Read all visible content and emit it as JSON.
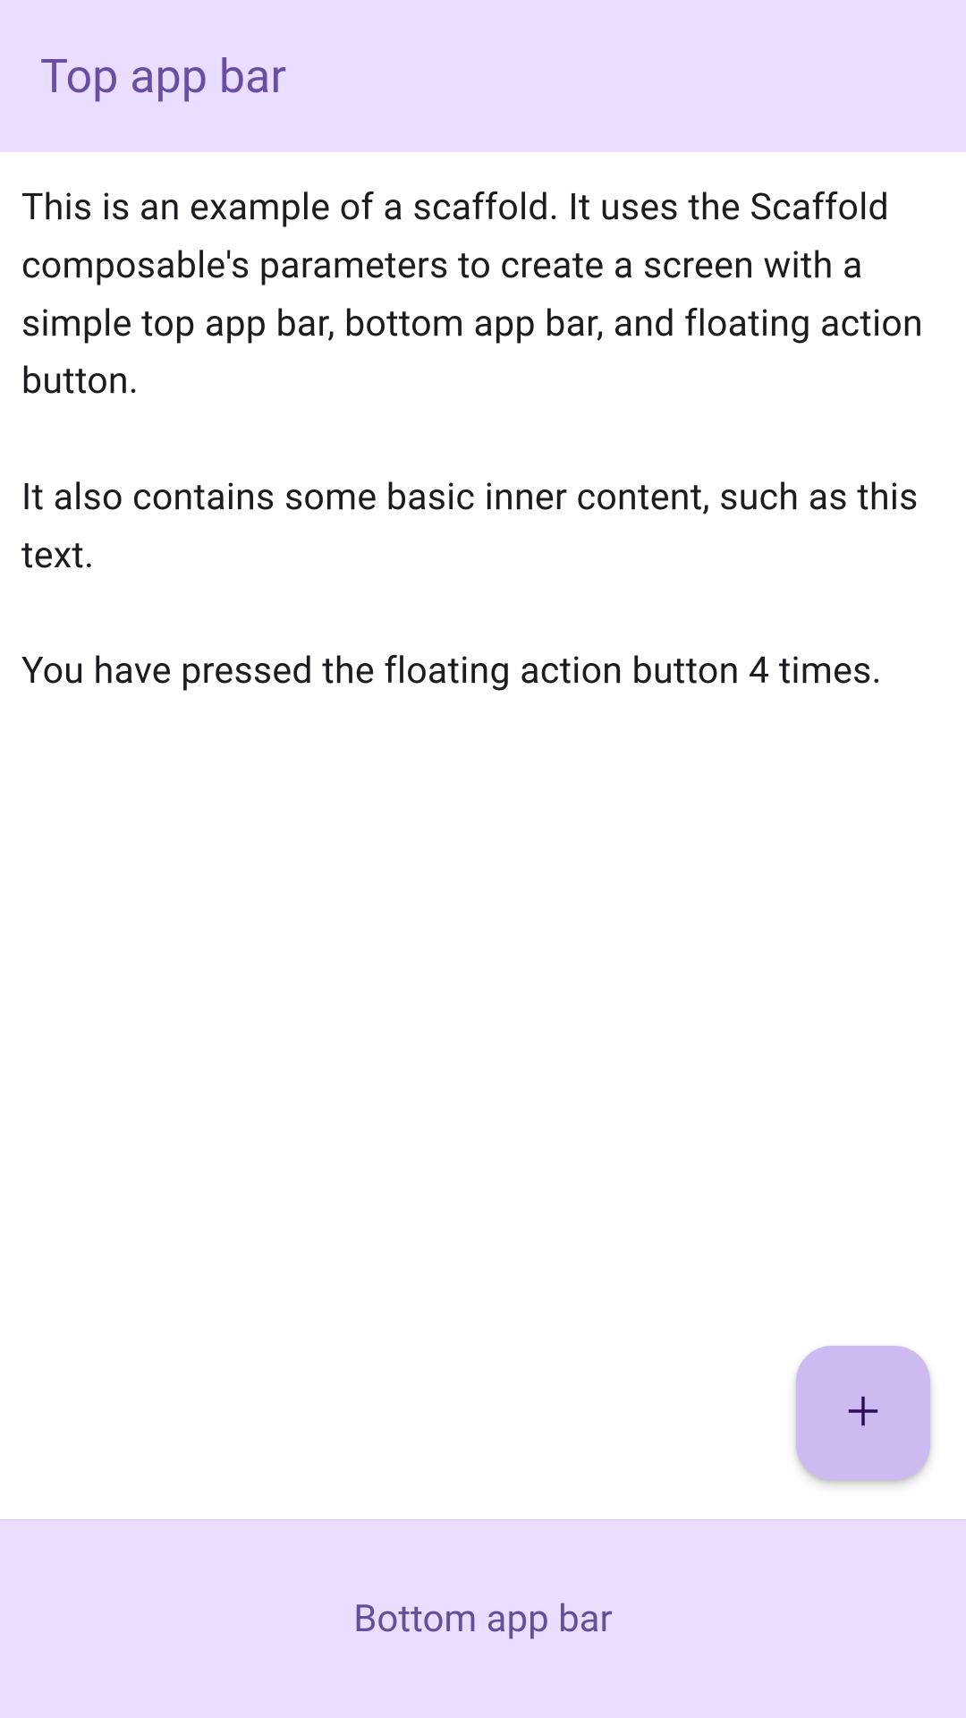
{
  "topBar": {
    "title": "Top app bar"
  },
  "content": {
    "text": "This is an example of a scaffold. It uses the Scaffold composable's parameters to create a screen with a simple top app bar, bottom app bar, and floating action button.\n\nIt also contains some basic inner content, such as this text.\n\nYou have pressed the floating action button 4 times."
  },
  "bottomBar": {
    "text": "Bottom app bar"
  },
  "fab": {
    "pressCount": 4
  },
  "colors": {
    "barBackground": "#eaddff",
    "barText": "#6a4ea3",
    "fabBackground": "#cdbaf0",
    "fabIcon": "#2e0c57",
    "contentText": "#1c1b1f"
  }
}
